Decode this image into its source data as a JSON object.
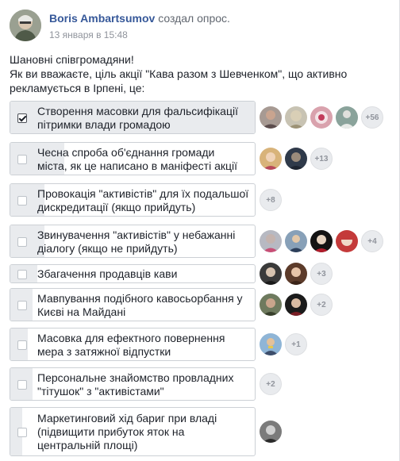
{
  "post": {
    "author": "Boris Ambartsumov",
    "action": "создал опрос.",
    "timestamp": "13 января в 15:48",
    "text_line1": "Шановні співгромадяни!",
    "text_line2": "Як ви вважаєте, ціль акції \"Кава разом з Шевченком\", що активно",
    "text_line3": "рекламується в Ірпені, це:"
  },
  "poll": {
    "options": [
      {
        "line1": "Створення масовки для фальсифікації",
        "line2": "пітримки влади громадою",
        "checked": true,
        "more": "+56"
      },
      {
        "line1": "Чесна спроба об'єднання громади",
        "line2": "міста, як це написано в маніфесті акції",
        "checked": false,
        "more": "+13"
      },
      {
        "line1": "Провокація \"активістів\" для їх подальшої",
        "line2": "дискредитації (якщо прийдуть)",
        "checked": false,
        "more": "+8"
      },
      {
        "line1": "Звинувачення \"активістів\" у небажанні",
        "line2": "діалогу (якщо не прийдуть)",
        "checked": false,
        "more": "+4"
      },
      {
        "line1": "Збагачення продавців кави",
        "line2": "",
        "checked": false,
        "more": "+3"
      },
      {
        "line1": "Мавпування подібного кавосьорбання у",
        "line2": "Києві на Майдані",
        "checked": false,
        "more": "+2"
      },
      {
        "line1": "Масовка для ефектного повернення",
        "line2": "мера з затяжної відпустки",
        "checked": false,
        "more": "+1"
      },
      {
        "line1": "Персональне знайомство провладних",
        "line2": "\"тітушок\" з \"активістами\"",
        "checked": false,
        "more": "+2"
      },
      {
        "line1": "Маркетинговий хід бариг при владі",
        "line2": "(підвищити прибуток яток на",
        "line3": "центральній площі)",
        "checked": false,
        "more": ""
      }
    ]
  },
  "colors": {
    "link": "#365899",
    "secondary": "#90949c",
    "border": "#ccd0d5",
    "fill": "#e9ebee"
  }
}
